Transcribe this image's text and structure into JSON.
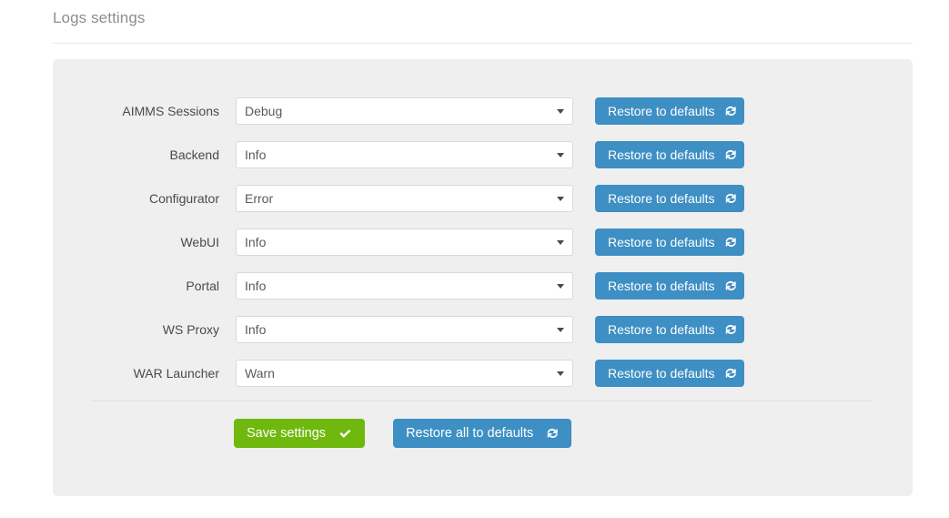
{
  "page": {
    "title": "Logs settings"
  },
  "form": {
    "rows": [
      {
        "label": "AIMMS Sessions",
        "value": "Debug",
        "restore_label": "Restore to defaults",
        "restore_icon": "refresh-icon"
      },
      {
        "label": "Backend",
        "value": "Info",
        "restore_label": "Restore to defaults",
        "restore_icon": "refresh-icon"
      },
      {
        "label": "Configurator",
        "value": "Error",
        "restore_label": "Restore to defaults",
        "restore_icon": "refresh-icon"
      },
      {
        "label": "WebUI",
        "value": "Info",
        "restore_label": "Restore to defaults",
        "restore_icon": "refresh-icon"
      },
      {
        "label": "Portal",
        "value": "Info",
        "restore_label": "Restore to defaults",
        "restore_icon": "refresh-icon"
      },
      {
        "label": "WS Proxy",
        "value": "Info",
        "restore_label": "Restore to defaults",
        "restore_icon": "refresh-icon"
      },
      {
        "label": "WAR Launcher",
        "value": "Warn",
        "restore_label": "Restore to defaults",
        "restore_icon": "refresh-icon"
      }
    ]
  },
  "footer": {
    "save_label": "Save settings",
    "save_icon": "check-icon",
    "restore_all_label": "Restore all to defaults",
    "restore_all_icon": "refresh-icon"
  },
  "colors": {
    "blue": "#3d8fc4",
    "green": "#6fb80d",
    "panel_bg": "#efefef",
    "title_text": "#8d8d8d",
    "label_text": "#4a4a4a",
    "select_text": "#5a5a5a",
    "select_border": "#d9d9d9",
    "divider": "#dedede"
  }
}
